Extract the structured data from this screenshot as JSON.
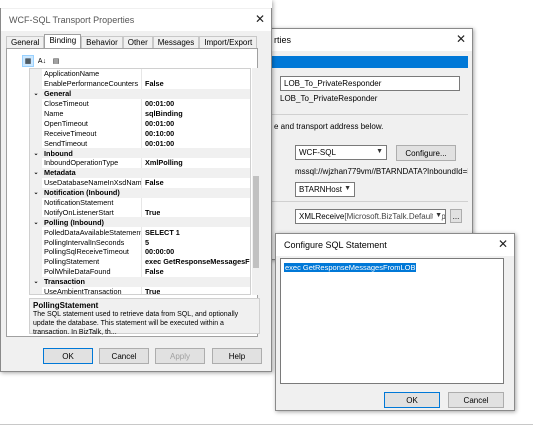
{
  "app_dialog": {
    "title": "rties",
    "port_name": "LOB_To_PrivateResponder",
    "port_name_label": "LOB_To_PrivateResponder",
    "transport_hint": "e and transport address below.",
    "transport_type": "WCF-SQL",
    "configure_button": "Configure...",
    "address_uri": "mssql://wjzhan779vm//BTARNDATA?InboundId=Resp",
    "host": "BTARNHost",
    "pipeline": "XMLReceive",
    "pipeline_detail": "[Microsoft.BizTalk.DefaultPip",
    "ellipsis_button": "..."
  },
  "properties_dialog": {
    "title": "WCF-SQL Transport Properties",
    "tabs": [
      "General",
      "Binding",
      "Behavior",
      "Other",
      "Messages",
      "Import/Export"
    ],
    "active_tab": "Binding",
    "rows": [
      {
        "kind": "prop",
        "name": "ApplicationName",
        "value": ""
      },
      {
        "kind": "prop",
        "name": "EnablePerformanceCounters",
        "value": "False"
      },
      {
        "kind": "cat",
        "name": "General"
      },
      {
        "kind": "prop",
        "name": "CloseTimeout",
        "value": "00:01:00"
      },
      {
        "kind": "prop",
        "name": "Name",
        "value": "sqlBinding"
      },
      {
        "kind": "prop",
        "name": "OpenTimeout",
        "value": "00:01:00"
      },
      {
        "kind": "prop",
        "name": "ReceiveTimeout",
        "value": "00:10:00"
      },
      {
        "kind": "prop",
        "name": "SendTimeout",
        "value": "00:01:00"
      },
      {
        "kind": "cat",
        "name": "Inbound"
      },
      {
        "kind": "prop",
        "name": "InboundOperationType",
        "value": "XmlPolling"
      },
      {
        "kind": "cat",
        "name": "Metadata"
      },
      {
        "kind": "prop",
        "name": "UseDatabaseNameInXsdNamesp",
        "value": "False"
      },
      {
        "kind": "cat",
        "name": "Notification (Inbound)"
      },
      {
        "kind": "prop",
        "name": "NotificationStatement",
        "value": ""
      },
      {
        "kind": "prop",
        "name": "NotifyOnListenerStart",
        "value": "True"
      },
      {
        "kind": "cat",
        "name": "Polling (Inbound)"
      },
      {
        "kind": "prop",
        "name": "PolledDataAvailableStatement",
        "value": "SELECT 1"
      },
      {
        "kind": "prop",
        "name": "PollingIntervalInSeconds",
        "value": "5"
      },
      {
        "kind": "prop",
        "name": "PollingSqlReceiveTimeout",
        "value": "00:00:00"
      },
      {
        "kind": "prop",
        "name": "PollingStatement",
        "value": "exec GetResponseMessagesFro"
      },
      {
        "kind": "prop",
        "name": "PollWhileDataFound",
        "value": "False"
      },
      {
        "kind": "cat",
        "name": "Transaction"
      },
      {
        "kind": "prop",
        "name": "UseAmbientTransaction",
        "value": "True"
      }
    ],
    "description_title": "PollingStatement",
    "description_text": "The SQL statement used to retrieve data from SQL, and optionally update the database. This statement will be executed within a transaction. In BizTalk, th...",
    "buttons": {
      "ok": "OK",
      "cancel": "Cancel",
      "apply": "Apply",
      "help": "Help"
    }
  },
  "sql_dialog": {
    "title": "Configure SQL Statement",
    "statement": "exec GetResponseMessagesFromLOB",
    "buttons": {
      "ok": "OK",
      "cancel": "Cancel"
    }
  }
}
